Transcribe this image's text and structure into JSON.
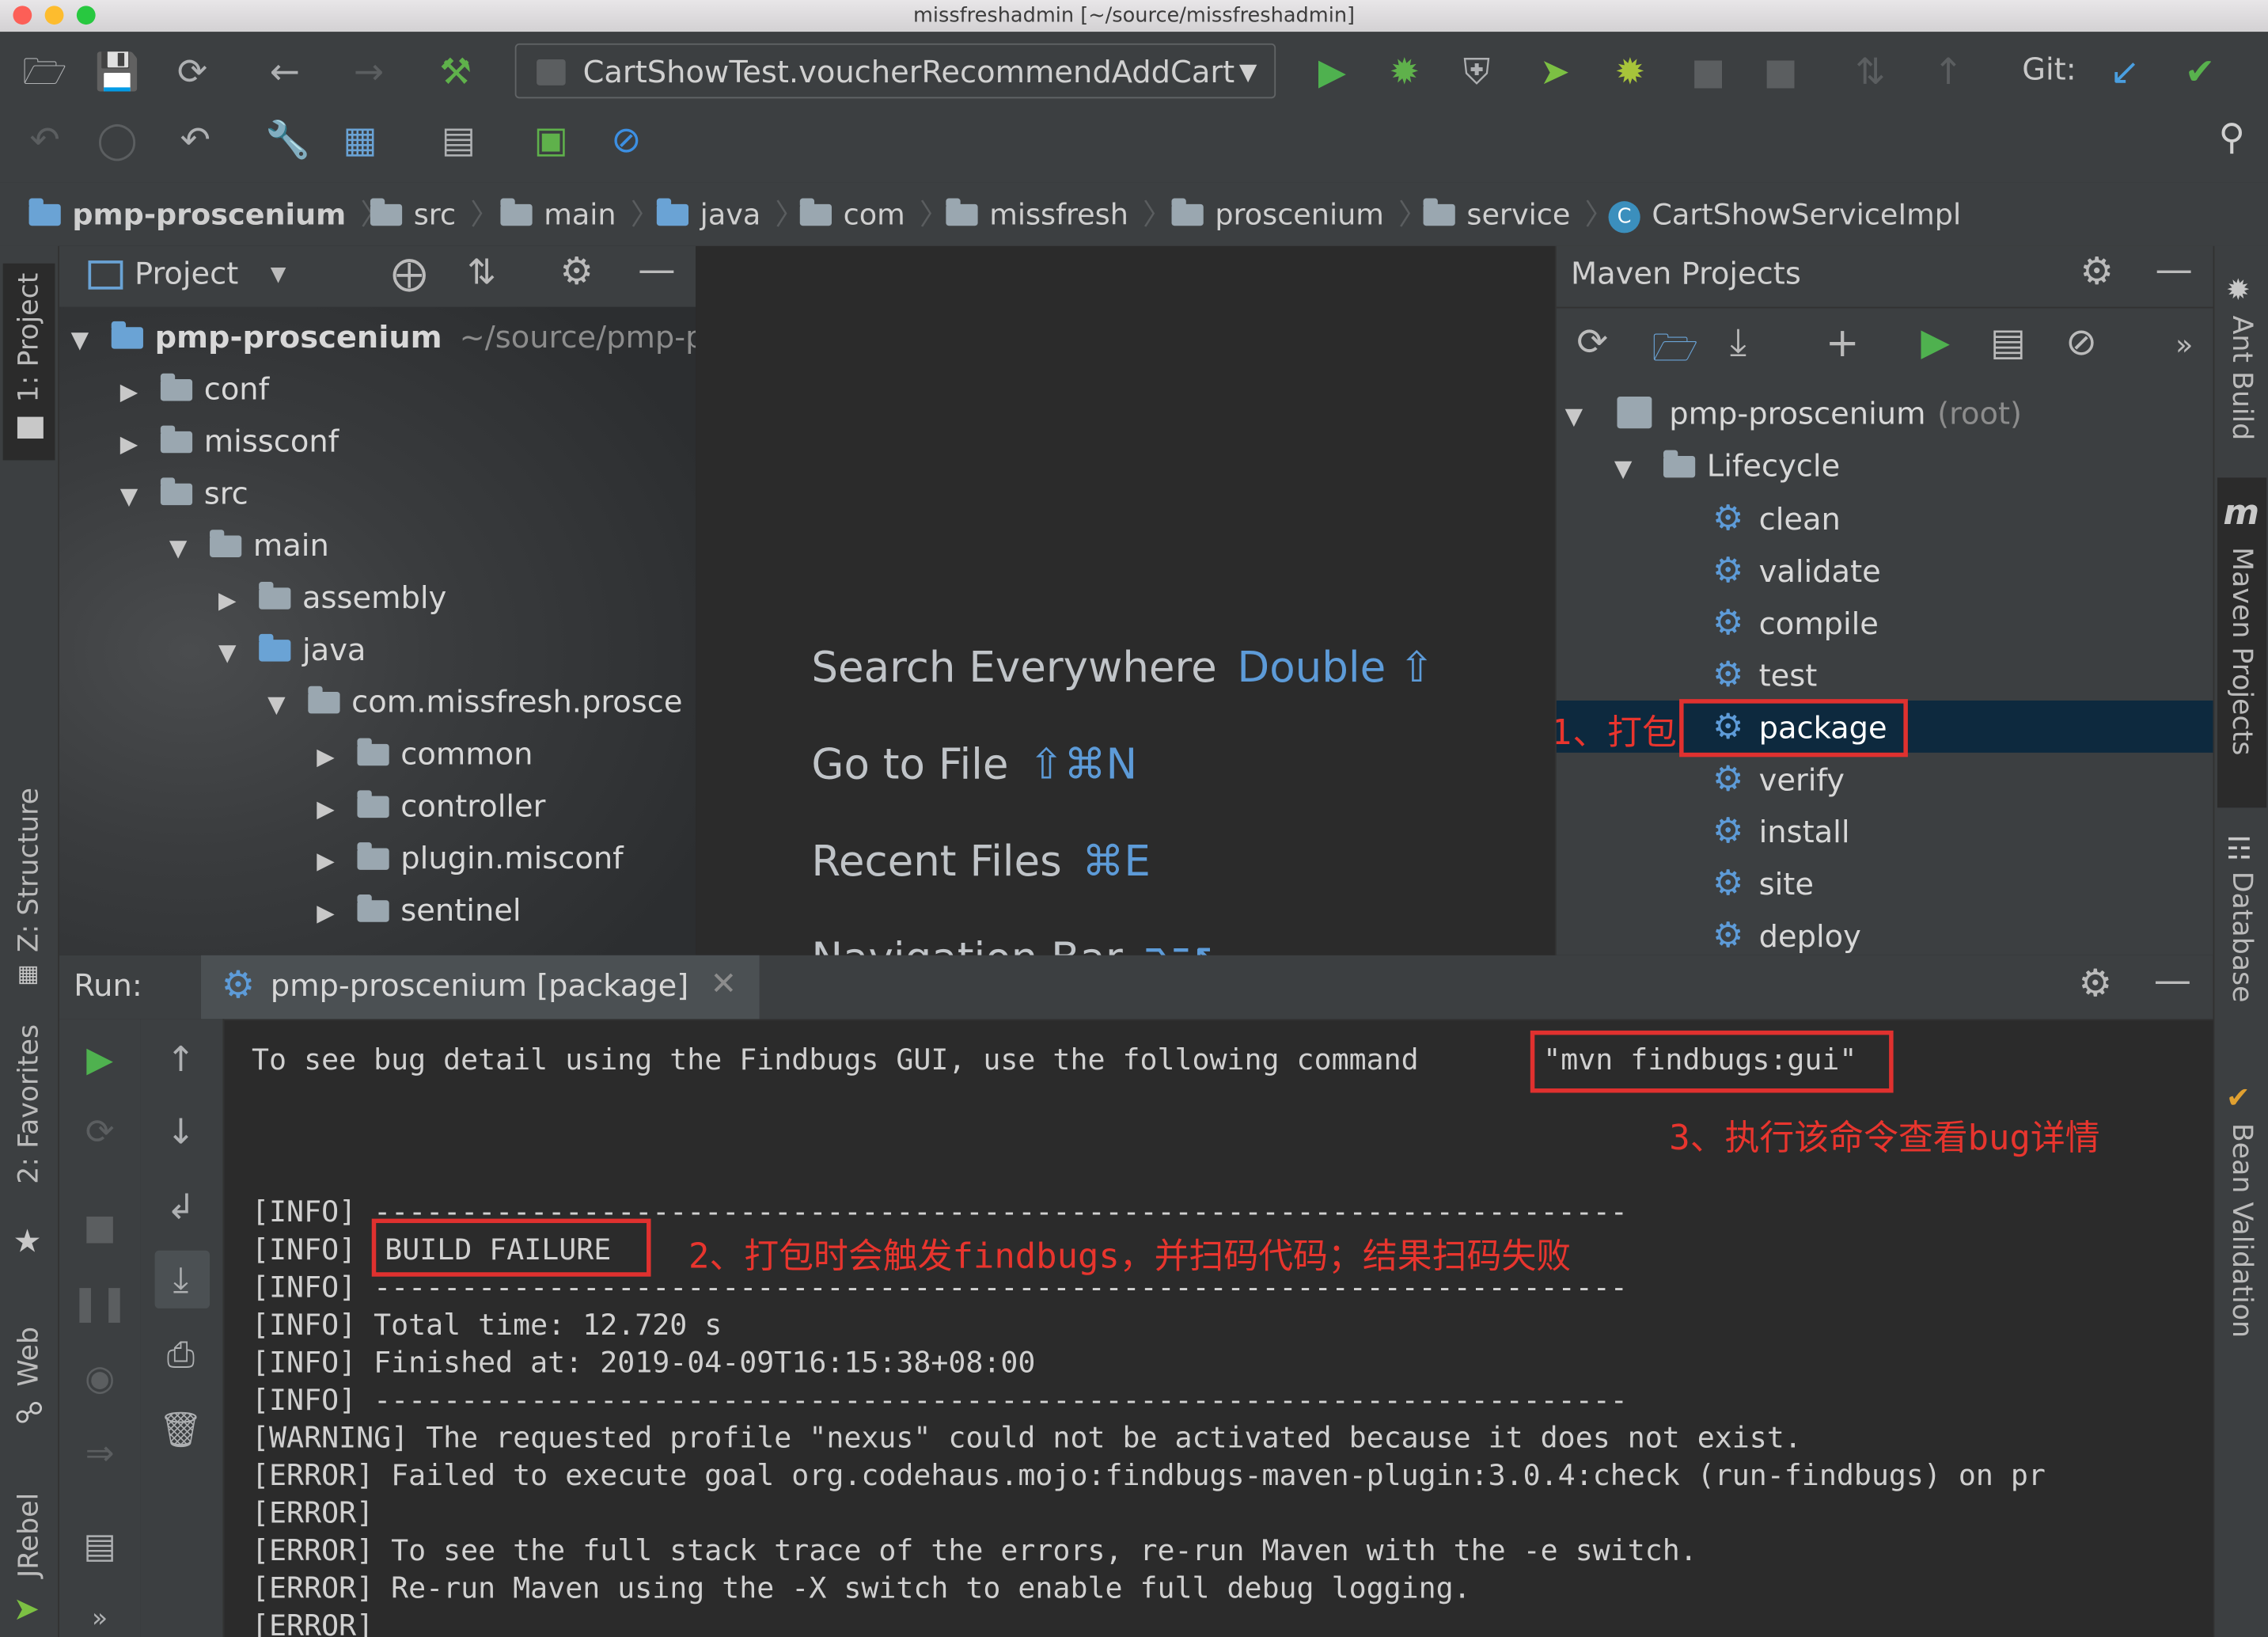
{
  "window": {
    "title": "missfreshadmin [~/source/missfreshadmin]"
  },
  "toolbar": {
    "run_config": "CartShowTest.voucherRecommendAddCart",
    "git_label": "Git:",
    "icons": [
      "open-folder-icon",
      "save-icon",
      "sync-icon",
      "back-icon",
      "forward-icon",
      "build-hammer-icon",
      "run-icon",
      "debug-icon",
      "coverage-icon",
      "jrebel-run-icon",
      "jrebel-debug-icon",
      "undo-icon",
      "settings-wrench-icon",
      "project-structure-icon",
      "sdk-icon",
      "profiler-icon",
      "no-entry-icon",
      "search-icon"
    ]
  },
  "breadcrumbs": [
    "pmp-proscenium",
    "src",
    "main",
    "java",
    "com",
    "missfresh",
    "proscenium",
    "service",
    "CartShowServiceImpl"
  ],
  "left_tabs": {
    "project": "1: Project",
    "structure": "Z: Structure",
    "favorites": "2: Favorites",
    "web": "Web",
    "jrebel": "JRebel"
  },
  "right_tabs": {
    "ant": "Ant Build",
    "maven": "Maven Projects",
    "database": "Database",
    "bean": "Bean Validation"
  },
  "project_panel": {
    "title": "Project",
    "root_name": "pmp-proscenium",
    "root_path": "~/source/pmp-p",
    "items": [
      "conf",
      "missconf",
      "src",
      "main",
      "assembly",
      "java",
      "com.missfresh.prosce",
      "common",
      "controller",
      "plugin.misconf",
      "sentinel"
    ]
  },
  "editor_hints": [
    {
      "label": "Search Everywhere",
      "keys": "Double ⇧"
    },
    {
      "label": "Go to File",
      "keys": "⇧⌘N"
    },
    {
      "label": "Recent Files",
      "keys": "⌘E"
    },
    {
      "label": "Navigation Bar",
      "keys": "⌥↖"
    }
  ],
  "maven_panel": {
    "title": "Maven Projects",
    "root_name": "pmp-proscenium",
    "root_suffix": "(root)",
    "lifecycle": "Lifecycle",
    "phases": [
      "clean",
      "validate",
      "compile",
      "test",
      "package",
      "verify",
      "install",
      "site",
      "deploy"
    ],
    "selected": "package"
  },
  "run_panel": {
    "label": "Run:",
    "tab": "pmp-proscenium [package]",
    "lines": [
      "To see bug detail using the Findbugs GUI, use the following command",
      "\"mvn findbugs:gui\"",
      "[INFO] ------------------------------------------------------------------------",
      "[INFO]",
      "BUILD FAILURE",
      "[INFO] ------------------------------------------------------------------------",
      "[INFO] Total time: 12.720 s",
      "[INFO] Finished at: 2019-04-09T16:15:38+08:00",
      "[INFO] ------------------------------------------------------------------------",
      "[WARNING] The requested profile \"nexus\" could not be activated because it does not exist.",
      "[ERROR] Failed to execute goal org.codehaus.mojo:findbugs-maven-plugin:3.0.4:check (run-findbugs) on pr",
      "[ERROR]",
      "[ERROR] To see the full stack trace of the errors, re-run Maven with the -e switch.",
      "[ERROR] Re-run Maven using the -X switch to enable full debug logging.",
      "[ERROR]"
    ]
  },
  "annotations": {
    "a1": "1、打包",
    "a2": "2、打包时会触发findbugs，并扫码代码；结果扫码失败",
    "a3": "3、执行该命令查看bug详情",
    "color": "#e8352e"
  }
}
